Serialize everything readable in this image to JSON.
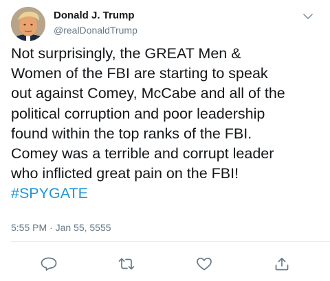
{
  "author": {
    "display_name": "Donald J. Trump",
    "handle": "@realDonaldTrump"
  },
  "tweet": {
    "lines": [
      "Not surprisingly, the GREAT Men &",
      "Women of the FBI are starting to speak",
      "out against Comey, McCabe and all of the",
      "political corruption and poor leadership",
      "found within the top ranks of the FBI.",
      "Comey was a terrible and corrupt leader",
      "who inflicted great pain on the FBI!"
    ],
    "hashtag": "#SPYGATE",
    "timestamp": "5:55 PM · Jan 55, 5555"
  },
  "icons": {
    "menu": "chevron-down-icon",
    "reply": "comment-icon",
    "retweet": "retweet-icon",
    "like": "heart-icon",
    "share": "share-icon"
  },
  "colors": {
    "text": "#14171a",
    "secondary": "#657786",
    "link": "#1b95e0",
    "divider": "#e6ecf0"
  }
}
